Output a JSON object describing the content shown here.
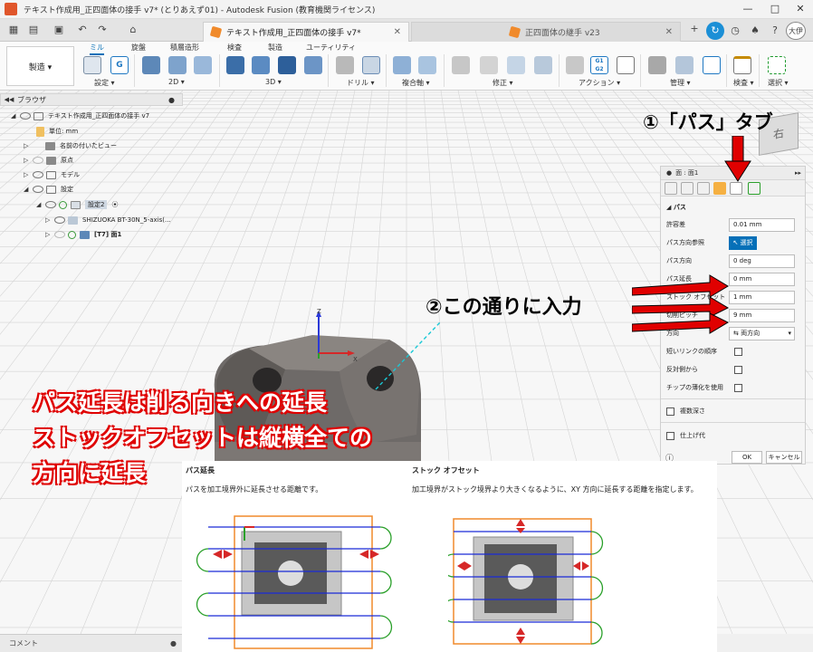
{
  "window": {
    "title": "テキスト作成用_正四面体の接手 v7* (とりあえず01) - Autodesk Fusion (教育機関ライセンス)",
    "min_glyph": "—",
    "max_glyph": "□",
    "close_glyph": "✕"
  },
  "tabs": {
    "active_label": "テキスト作成用_正四面体の接手 v7*",
    "inactive_label": "正四面体の継手 v23",
    "close_glyph": "✕"
  },
  "user": {
    "initials": "大伊"
  },
  "ribbon": {
    "workspace_label": "製造 ▾",
    "tabs": [
      "ミル",
      "旋盤",
      "積層造形",
      "検査",
      "製造",
      "ユーティリティ"
    ],
    "groups": [
      "設定 ▾",
      "2D ▾",
      "3D ▾",
      "ドリル ▾",
      "複合軸 ▾",
      "修正 ▾",
      "アクション ▾",
      "管理 ▾",
      "検査 ▾",
      "選択 ▾"
    ],
    "g1g2_label": "G1 G2"
  },
  "browser": {
    "header": "ブラウザ",
    "items": [
      "テキスト作成用_正四面体の接手 v7",
      "単位: mm",
      "名前の付いたビュー",
      "原点",
      "モデル",
      "設定",
      "設定2",
      "SHIZUOKA BT-30N_5-axis(...",
      "[T7] 面1"
    ]
  },
  "viewport": {
    "axis_z": "Z",
    "axis_x": "X",
    "viewcube_face": "右"
  },
  "panel": {
    "title": "面 : 面1",
    "section_label": "パス",
    "rows": [
      {
        "label": "許容差",
        "value": "0.01 mm"
      },
      {
        "label": "パス方向参照",
        "value": "選択"
      },
      {
        "label": "パス方向",
        "value": "0 deg"
      },
      {
        "label": "パス延長",
        "value": "0 mm"
      },
      {
        "label": "ストック オフセット",
        "value": "1 mm"
      },
      {
        "label": "切削ピッチ",
        "value": "9 mm"
      },
      {
        "label": "方向",
        "value": "両方向"
      },
      {
        "label": "短いリンクの順序",
        "value": ""
      },
      {
        "label": "反対側から",
        "value": ""
      },
      {
        "label": "チップの薄化を使用",
        "value": ""
      }
    ],
    "multi_depth": "複数深さ",
    "finishing": "仕上げ代",
    "ok": "OK",
    "cancel": "キャンセル"
  },
  "annotations": {
    "tab_note": "①「パス」タブ",
    "input_note": "②この通りに入力",
    "explain_line1": "パス延長は削る向きへの延長",
    "explain_line2": "ストックオフセットは縦横全ての",
    "explain_line3": "方向に延長"
  },
  "inset": {
    "left_title": "パス延長",
    "left_desc": "パスを加工境界外に延長させる距離です。",
    "right_title": "ストック オフセット",
    "right_desc": "加工境界がストック境界より大きくなるように、XY 方向に延長する距離を指定します。"
  },
  "status": {
    "comment": "コメント"
  },
  "colors": {
    "accent": "#0670b8",
    "annotation_red": "#e00000",
    "orange": "#f08a2b",
    "path_blue": "#1a2bd6",
    "path_green": "#2aa02a"
  }
}
